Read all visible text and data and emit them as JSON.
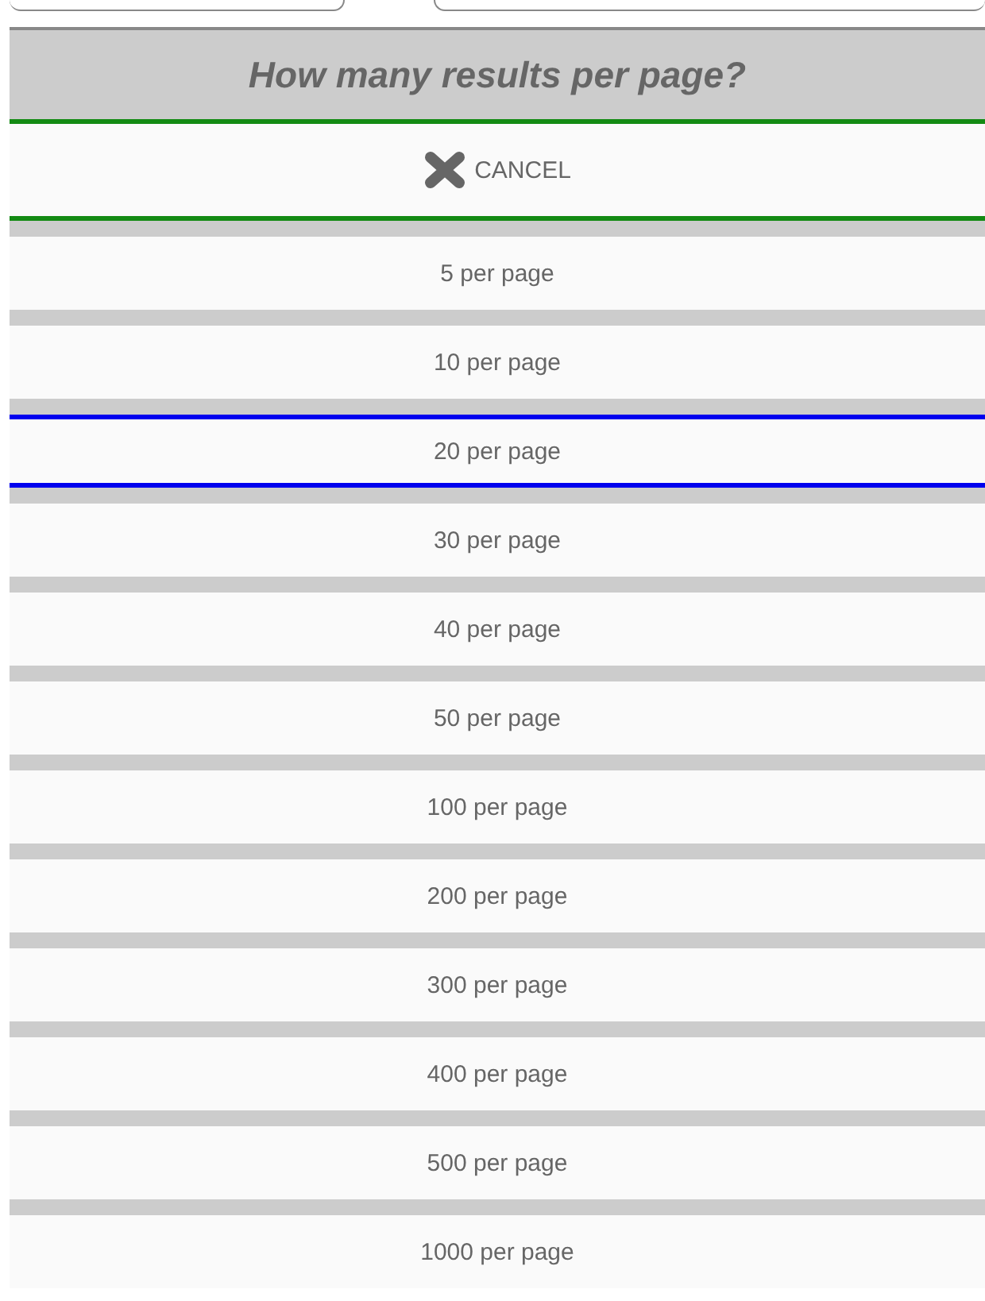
{
  "top_fields": [
    {
      "kind": "left"
    },
    {
      "kind": "right"
    }
  ],
  "dialog": {
    "title": "How many results per page?",
    "cancel": "CANCEL",
    "options": [
      {
        "label": "5 per page",
        "selected": false
      },
      {
        "label": "10 per page",
        "selected": false
      },
      {
        "label": "20 per page",
        "selected": true
      },
      {
        "label": "30 per page",
        "selected": false
      },
      {
        "label": "40 per page",
        "selected": false
      },
      {
        "label": "50 per page",
        "selected": false
      },
      {
        "label": "100 per page",
        "selected": false
      },
      {
        "label": "200 per page",
        "selected": false
      },
      {
        "label": "300 per page",
        "selected": false
      },
      {
        "label": "400 per page",
        "selected": false
      },
      {
        "label": "500 per page",
        "selected": false
      },
      {
        "label": "1000 per page",
        "selected": false
      }
    ]
  }
}
